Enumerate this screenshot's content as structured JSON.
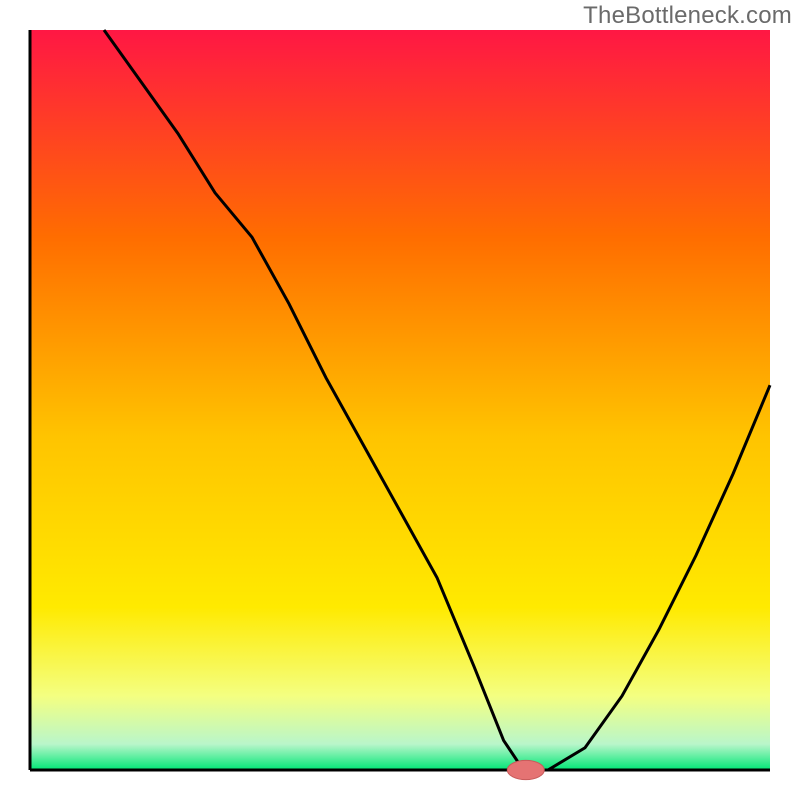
{
  "watermark": "TheBottleneck.com",
  "colors": {
    "axis": "#000000",
    "curve": "#000000",
    "marker_fill": "#e57373",
    "marker_stroke": "#c85a5a",
    "gradient_top": "#ff1744",
    "gradient_mid_upper": "#ff8a00",
    "gradient_mid": "#ffd600",
    "gradient_mid_lower": "#ffeb3b",
    "gradient_low": "#fff176",
    "gradient_bottom": "#00e676"
  },
  "chart_data": {
    "type": "line",
    "title": "",
    "xlabel": "",
    "ylabel": "",
    "xlim": [
      0,
      100
    ],
    "ylim": [
      0,
      100
    ],
    "curve": {
      "x": [
        10,
        15,
        20,
        25,
        30,
        35,
        40,
        45,
        50,
        55,
        60,
        62,
        64,
        66,
        68,
        70,
        75,
        80,
        85,
        90,
        95,
        100
      ],
      "y": [
        100,
        93,
        86,
        78,
        72,
        63,
        53,
        44,
        35,
        26,
        14,
        9,
        4,
        1,
        0,
        0,
        3,
        10,
        19,
        29,
        40,
        52
      ]
    },
    "optimum_marker": {
      "x": 67,
      "y": 0,
      "rx": 2.5,
      "ry": 1.3
    },
    "background_gradient_stops": [
      {
        "offset": 0.0,
        "color": "#ff1744"
      },
      {
        "offset": 0.28,
        "color": "#ff6d00"
      },
      {
        "offset": 0.55,
        "color": "#ffc400"
      },
      {
        "offset": 0.78,
        "color": "#ffea00"
      },
      {
        "offset": 0.9,
        "color": "#f4ff81"
      },
      {
        "offset": 0.965,
        "color": "#b9f6ca"
      },
      {
        "offset": 1.0,
        "color": "#00e676"
      }
    ]
  }
}
